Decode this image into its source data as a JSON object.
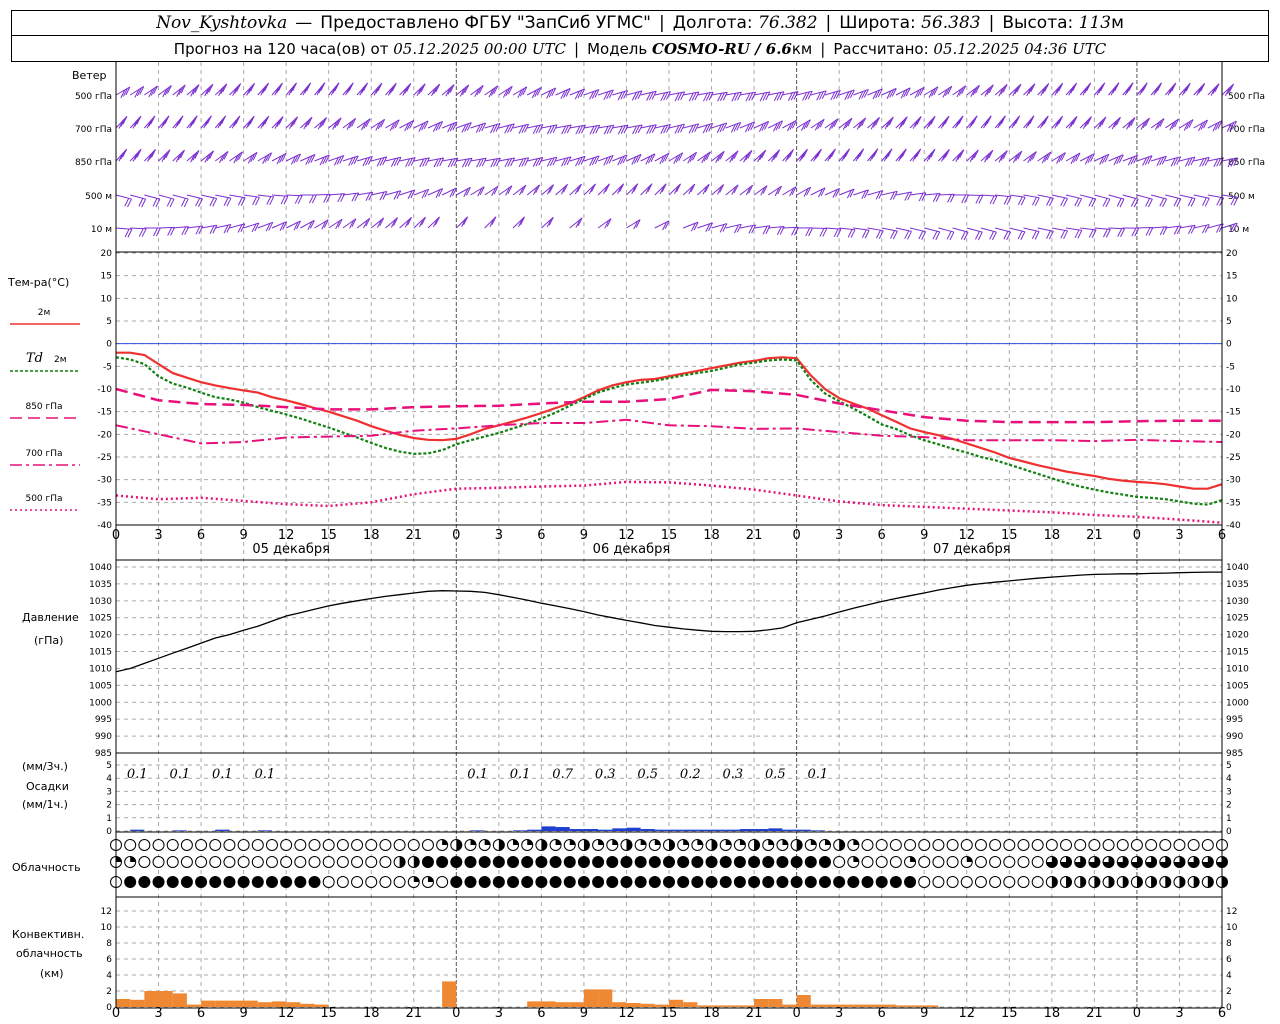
{
  "header": {
    "station": "Nov_Kyshtovka",
    "dash": "—",
    "provider": "Предоставлено ФГБУ \"ЗапСиб УГМС\"",
    "lon_label": "Долгота:",
    "lon_value": "76.382",
    "lat_label": "Широта:",
    "lat_value": "56.383",
    "alt_label": "Высота:",
    "alt_value": "113",
    "alt_unit": "м",
    "forecast_label": "Прогноз на 120 часа(ов) от",
    "forecast_start": "05.12.2025 00:00 UTC",
    "model_label": "Модель",
    "model_value": "COSMO-RU / 6.6",
    "model_unit": "км",
    "calc_label": "Рассчитано:",
    "calc_value": "05.12.2025 04:36 UTC"
  },
  "colors": {
    "wind": "#7B2FD0",
    "t2m": "#F03030",
    "td2m": "#108010",
    "t850": "#E8107A",
    "t700": "#E8107A",
    "t500": "#E8107A",
    "zero_line": "#3050E0",
    "pressure": "#000000",
    "precip": "#1F3FD0",
    "convective": "#EE8833",
    "grid": "#AAAAAA"
  },
  "x_axis": {
    "ticks": [
      "0",
      "3",
      "6",
      "9",
      "12",
      "15",
      "18",
      "21",
      "0",
      "3",
      "6",
      "9",
      "12",
      "15",
      "18",
      "21",
      "0",
      "3",
      "6",
      "9",
      "12",
      "15",
      "18",
      "21",
      "0",
      "3",
      "6"
    ],
    "dates": [
      "05 декабря",
      "06 декабря",
      "07 декабря"
    ]
  },
  "wind_panel": {
    "title": "Ветер",
    "levels": [
      "500 гПа",
      "700 гПа",
      "850 гПа",
      "500 м",
      "10 м"
    ],
    "icon": "wind-barb-icon"
  },
  "temp_panel": {
    "title": "Тем-ра(°C)",
    "legend": [
      {
        "label": "2м",
        "style": "solid"
      },
      {
        "label_a": "Td",
        "label": "2м",
        "style": "dotted"
      },
      {
        "label": "850 гПа",
        "style": "dashed"
      },
      {
        "label": "700 гПа",
        "style": "dashdot"
      },
      {
        "label": "500 гПа",
        "style": "dotted"
      }
    ],
    "y_ticks": [
      "20",
      "15",
      "10",
      "5",
      "0",
      "-5",
      "-10",
      "-15",
      "-20",
      "-25",
      "-30",
      "-35",
      "-40"
    ]
  },
  "pressure_panel": {
    "title": "Давление",
    "unit": "(гПа)",
    "y_ticks": [
      "1040",
      "1035",
      "1030",
      "1025",
      "1020",
      "1015",
      "1010",
      "1005",
      "1000",
      "995",
      "990",
      "985"
    ]
  },
  "precip_panel": {
    "title_unit3": "(мм/3ч.)",
    "title": "Осадки",
    "title_unit1": "(мм/1ч.)",
    "y_ticks": [
      "5",
      "4",
      "3",
      "2",
      "1",
      "0"
    ],
    "labels": [
      {
        "h": 1.5,
        "text": "0.1"
      },
      {
        "h": 4.5,
        "text": "0.1"
      },
      {
        "h": 7.5,
        "text": "0.1"
      },
      {
        "h": 10.5,
        "text": "0.1"
      },
      {
        "h": 25.5,
        "text": "0.1"
      },
      {
        "h": 28.5,
        "text": "0.1"
      },
      {
        "h": 31.5,
        "text": "0.7"
      },
      {
        "h": 34.5,
        "text": "0.3"
      },
      {
        "h": 37.5,
        "text": "0.5"
      },
      {
        "h": 40.5,
        "text": "0.2"
      },
      {
        "h": 43.5,
        "text": "0.3"
      },
      {
        "h": 46.5,
        "text": "0.5"
      },
      {
        "h": 49.5,
        "text": "0.1"
      }
    ]
  },
  "cloud_panel": {
    "title": "Облачность",
    "icon": "cloud-cover-icon"
  },
  "conv_panel": {
    "title1": "Конвективн.",
    "title2": "облачность",
    "unit": "(км)",
    "y_ticks": [
      "12",
      "10",
      "8",
      "6",
      "4",
      "2",
      "0"
    ]
  },
  "chart_data": [
    {
      "type": "line",
      "title": "Тем-ра(°C)",
      "x_unit": "hours since 05.12.2025 00:00 UTC",
      "ylim": [
        -40,
        20
      ],
      "series": [
        {
          "name": "2м",
          "x": [
            0,
            1,
            2,
            3,
            4,
            5,
            6,
            7,
            8,
            9,
            10,
            11,
            12,
            13,
            14,
            15,
            16,
            17,
            18,
            19,
            20,
            21,
            22,
            23,
            24,
            25,
            26,
            27,
            28,
            29,
            30,
            31,
            32,
            33,
            34,
            35,
            36,
            37,
            38,
            39,
            40,
            41,
            42,
            43,
            44,
            45,
            46,
            47,
            48,
            49,
            50,
            51,
            52,
            53,
            54,
            55,
            56,
            57,
            58,
            59,
            60,
            61,
            62,
            63,
            64,
            65,
            66,
            67,
            68,
            69,
            70,
            71,
            72,
            73,
            74,
            75,
            76,
            77,
            78
          ],
          "values": [
            -2,
            -2,
            -2.5,
            -4.5,
            -6.5,
            -7.5,
            -8.5,
            -9.2,
            -9.8,
            -10.3,
            -10.8,
            -11.8,
            -12.5,
            -13.3,
            -14.2,
            -15,
            -16,
            -17,
            -18.2,
            -19.2,
            -20.1,
            -20.8,
            -21.2,
            -21.3,
            -21,
            -20,
            -18.8,
            -18,
            -17.2,
            -16.3,
            -15.3,
            -14.2,
            -13.2,
            -11.8,
            -10.3,
            -9.2,
            -8.5,
            -8,
            -7.8,
            -7.2,
            -6.6,
            -6,
            -5.4,
            -4.8,
            -4.2,
            -3.8,
            -3.2,
            -3,
            -3.2,
            -7,
            -10,
            -12,
            -13.2,
            -14.3,
            -15.8,
            -17.2,
            -18.7,
            -19.5,
            -20.2,
            -21,
            -22,
            -23,
            -24,
            -25.2,
            -26,
            -26.8,
            -27.5,
            -28.2,
            -28.7,
            -29.2,
            -29.8,
            -30.2,
            -30.5,
            -30.7,
            -31,
            -31.5,
            -32,
            -32,
            -31
          ]
        },
        {
          "name": "Td 2м",
          "x": [
            0,
            1,
            2,
            3,
            4,
            5,
            6,
            7,
            8,
            9,
            10,
            11,
            12,
            13,
            14,
            15,
            16,
            17,
            18,
            19,
            20,
            21,
            22,
            23,
            24,
            25,
            26,
            27,
            28,
            29,
            30,
            31,
            32,
            33,
            34,
            35,
            36,
            37,
            38,
            39,
            40,
            41,
            42,
            43,
            44,
            45,
            46,
            47,
            48,
            49,
            50,
            51,
            52,
            53,
            54,
            55,
            56,
            57,
            58,
            59,
            60,
            61,
            62,
            63,
            64,
            65,
            66,
            67,
            68,
            69,
            70,
            71,
            72,
            73,
            74,
            75,
            76,
            77,
            78
          ],
          "values": [
            -3,
            -3.5,
            -4.5,
            -7.2,
            -8.8,
            -9.7,
            -10.8,
            -11.8,
            -12.3,
            -13,
            -14,
            -14.8,
            -15.6,
            -16.5,
            -17.5,
            -18.5,
            -19.6,
            -20.7,
            -21.9,
            -23,
            -23.8,
            -24.3,
            -24.2,
            -23.5,
            -22.2,
            -21.3,
            -20.5,
            -19.7,
            -18.7,
            -17.7,
            -16.5,
            -15.2,
            -13.7,
            -12.2,
            -10.8,
            -9.8,
            -9,
            -8.6,
            -8.2,
            -7.6,
            -7,
            -6.5,
            -6,
            -5.3,
            -4.6,
            -4.2,
            -3.7,
            -3.5,
            -3.7,
            -8,
            -11,
            -12.7,
            -14.3,
            -16,
            -17.8,
            -18.8,
            -20.2,
            -21.3,
            -22.2,
            -23.2,
            -24,
            -25,
            -25.7,
            -26.7,
            -27.7,
            -28.7,
            -29.7,
            -30.7,
            -31.5,
            -32.2,
            -32.8,
            -33.3,
            -33.8,
            -34,
            -34.3,
            -34.8,
            -35.3,
            -35.5,
            -34.5
          ]
        },
        {
          "name": "850 гПа",
          "x": [
            0,
            3,
            6,
            9,
            12,
            15,
            18,
            21,
            24,
            27,
            30,
            33,
            36,
            39,
            42,
            45,
            48,
            51,
            54,
            57,
            60,
            63,
            66,
            69,
            72,
            75,
            78
          ],
          "values": [
            -10,
            -12.5,
            -13.3,
            -13.5,
            -14,
            -14.5,
            -14.5,
            -14,
            -13.8,
            -13.7,
            -13.2,
            -12.8,
            -12.8,
            -12.2,
            -10.2,
            -10.5,
            -11.3,
            -13.2,
            -14.7,
            -16.2,
            -17,
            -17.3,
            -17.3,
            -17.3,
            -17.1,
            -17,
            -17
          ]
        },
        {
          "name": "700 гПа",
          "x": [
            0,
            3,
            6,
            9,
            12,
            15,
            18,
            21,
            24,
            27,
            30,
            33,
            36,
            39,
            42,
            45,
            48,
            51,
            54,
            57,
            60,
            63,
            66,
            69,
            72,
            75,
            78
          ],
          "values": [
            -18,
            -20,
            -22,
            -21.7,
            -20.7,
            -20.5,
            -20.3,
            -19.2,
            -18.7,
            -18,
            -17.5,
            -17.5,
            -16.8,
            -18,
            -18.2,
            -18.8,
            -18.7,
            -19.5,
            -20.3,
            -20.6,
            -21.3,
            -21.3,
            -21.3,
            -21.5,
            -21.2,
            -21.5,
            -21.7
          ]
        },
        {
          "name": "500 гПа",
          "x": [
            0,
            3,
            6,
            9,
            12,
            15,
            18,
            21,
            24,
            27,
            30,
            33,
            36,
            39,
            42,
            45,
            48,
            51,
            54,
            57,
            60,
            63,
            66,
            69,
            72,
            75,
            78
          ],
          "values": [
            -33.5,
            -34.3,
            -34,
            -34.7,
            -35.4,
            -35.8,
            -35,
            -33.2,
            -32,
            -31.8,
            -31.5,
            -31.3,
            -30.5,
            -30.6,
            -31.3,
            -32.2,
            -33.5,
            -34.8,
            -35.6,
            -36,
            -36.4,
            -36.8,
            -37.2,
            -37.8,
            -38.2,
            -38.8,
            -39.5
          ]
        }
      ]
    },
    {
      "type": "line",
      "title": "Давление",
      "ylabel": "(гПа)",
      "ylim": [
        985,
        1040
      ],
      "series": [
        {
          "name": "Давление",
          "x": [
            0,
            1,
            2,
            3,
            4,
            5,
            6,
            7,
            8,
            9,
            10,
            11,
            12,
            13,
            14,
            15,
            16,
            17,
            18,
            19,
            20,
            21,
            22,
            23,
            24,
            25,
            26,
            27,
            28,
            29,
            30,
            31,
            32,
            33,
            34,
            35,
            36,
            37,
            38,
            39,
            40,
            41,
            42,
            43,
            44,
            45,
            46,
            47,
            48,
            49,
            50,
            51,
            52,
            53,
            54,
            55,
            56,
            57,
            58,
            59,
            60,
            61,
            62,
            63,
            64,
            65,
            66,
            67,
            68,
            69,
            70,
            71,
            72,
            73,
            74,
            75,
            76,
            77,
            78
          ],
          "values": [
            1009,
            1010,
            1011.5,
            1013,
            1014.5,
            1016,
            1017.5,
            1019,
            1020,
            1021.3,
            1022.5,
            1024,
            1025.5,
            1026.5,
            1027.5,
            1028.5,
            1029.3,
            1030,
            1030.7,
            1031.3,
            1031.8,
            1032.3,
            1032.8,
            1033,
            1032.9,
            1032.8,
            1032.5,
            1031.8,
            1031,
            1030.2,
            1029.3,
            1028.5,
            1027.7,
            1026.8,
            1025.8,
            1025,
            1024.2,
            1023.5,
            1022.7,
            1022.2,
            1021.7,
            1021.3,
            1021,
            1020.9,
            1020.9,
            1021,
            1021.4,
            1022,
            1023.5,
            1024.5,
            1025.5,
            1026.7,
            1027.8,
            1028.8,
            1029.8,
            1030.7,
            1031.5,
            1032.3,
            1033.2,
            1033.9,
            1034.6,
            1035.1,
            1035.5,
            1035.9,
            1036.3,
            1036.7,
            1037,
            1037.3,
            1037.6,
            1037.8,
            1037.9,
            1038,
            1038,
            1038.1,
            1038.2,
            1038.3,
            1038.4,
            1038.5,
            1038.5
          ]
        }
      ]
    },
    {
      "type": "bar",
      "title": "Осадки",
      "ylim": [
        0,
        5
      ],
      "x": [
        1.5,
        4.5,
        7.5,
        10.5,
        25.5,
        28.5,
        29.5,
        30.5,
        31.5,
        32.5,
        33.5,
        34.5,
        35.5,
        36.5,
        37.5,
        38.5,
        39.5,
        40.5,
        41.5,
        42.5,
        43.5,
        44.5,
        45.5,
        46.5,
        47.5,
        48.5,
        49.5
      ],
      "values": [
        0.1,
        0.05,
        0.1,
        0.05,
        0.05,
        0.05,
        0.1,
        0.35,
        0.3,
        0.15,
        0.15,
        0.1,
        0.2,
        0.25,
        0.15,
        0.1,
        0.1,
        0.1,
        0.1,
        0.1,
        0.1,
        0.15,
        0.15,
        0.2,
        0.1,
        0.1,
        0.05
      ]
    },
    {
      "type": "bar",
      "title": "Конвективн. облачность",
      "ylabel": "(км)",
      "ylim": [
        0,
        13
      ],
      "x": [
        0.5,
        1.5,
        2.5,
        3.5,
        4.5,
        5.5,
        6.5,
        7.5,
        8.5,
        9.5,
        10.5,
        11.5,
        12.5,
        13.5,
        14.5,
        23.5,
        29.5,
        30.5,
        31.5,
        32.5,
        33.5,
        34.5,
        35.5,
        36.5,
        37.5,
        38.5,
        39.5,
        40.5,
        41.5,
        42.5,
        43.5,
        44.5,
        45.5,
        46.5,
        47.5,
        48.5,
        49.5,
        50.5,
        51.5,
        52.5,
        53.5,
        54.5,
        55.5,
        56.5,
        57.5
      ],
      "values": [
        1.0,
        0.9,
        2.0,
        2.0,
        1.7,
        0.3,
        0.8,
        0.8,
        0.8,
        0.8,
        0.6,
        0.7,
        0.6,
        0.4,
        0.3,
        3.2,
        0.7,
        0.7,
        0.6,
        0.6,
        2.2,
        2.2,
        0.6,
        0.5,
        0.4,
        0.3,
        0.9,
        0.6,
        0.2,
        0.2,
        0.2,
        0.2,
        1.0,
        1.0,
        0.3,
        1.5,
        0.3,
        0.3,
        0.3,
        0.3,
        0.3,
        0.3,
        0.2,
        0.2,
        0.2
      ]
    }
  ]
}
